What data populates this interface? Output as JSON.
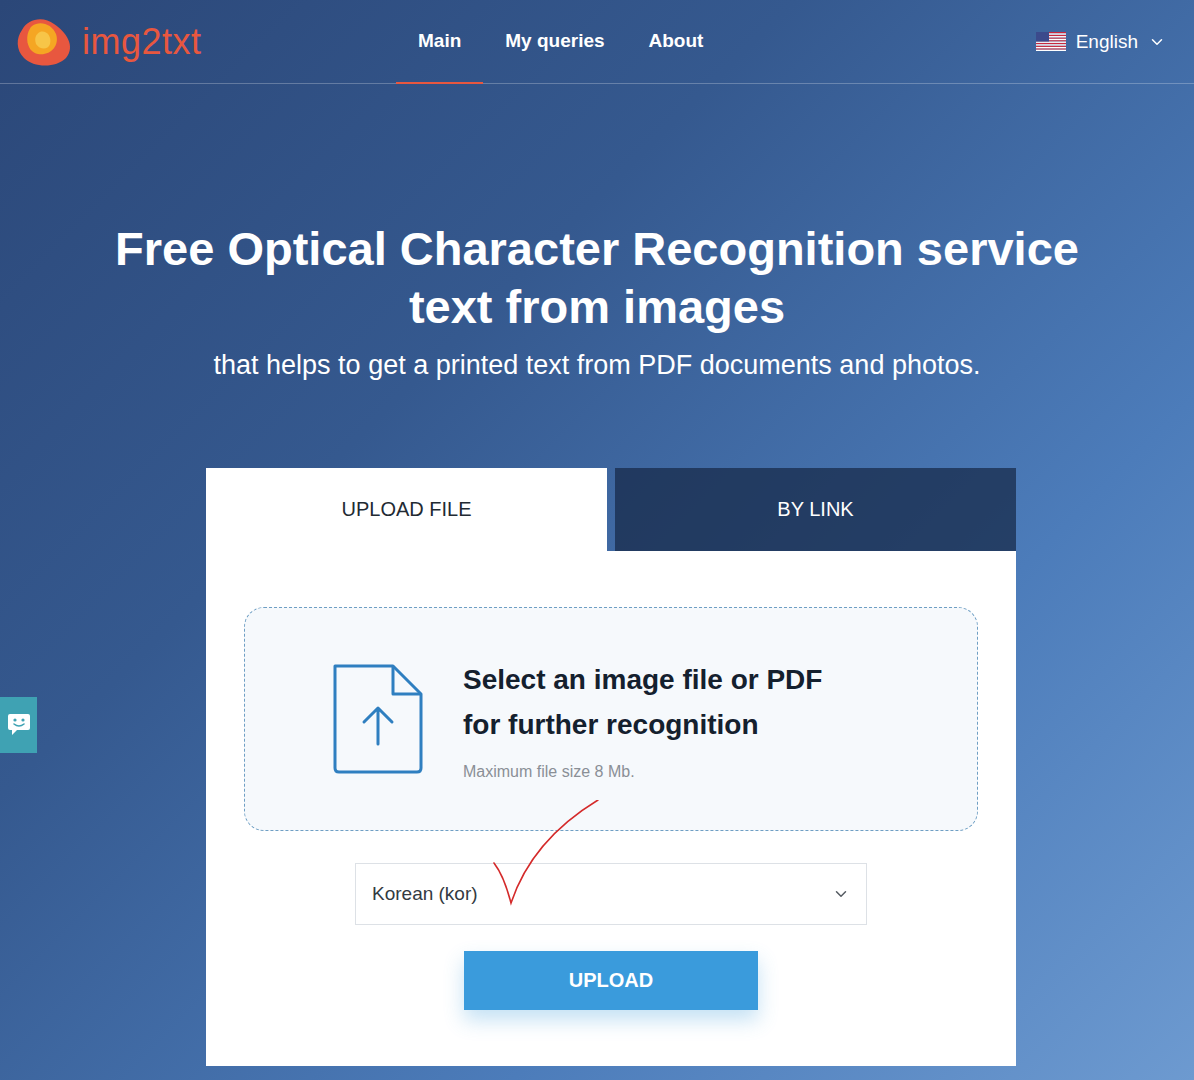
{
  "header": {
    "logo": "img2txt",
    "nav": [
      {
        "label": "Main",
        "selected": true
      },
      {
        "label": "My queries",
        "selected": false
      },
      {
        "label": "About",
        "selected": false
      }
    ],
    "language": "English"
  },
  "hero": {
    "title": [
      "Free Optical Character Recognition service",
      "text from images"
    ],
    "subtitle": "that helps to get a printed text from PDF documents and photos."
  },
  "tabs": [
    {
      "label": "UPLOAD FILE",
      "selected": true
    },
    {
      "label": "BY LINK",
      "selected": false
    }
  ],
  "upload": {
    "prompt": [
      "Select an image file or PDF",
      "for further recognition"
    ],
    "limit": "Maximum file size 8 Mb.",
    "language": "Korean (kor)",
    "button": "UPLOAD"
  }
}
